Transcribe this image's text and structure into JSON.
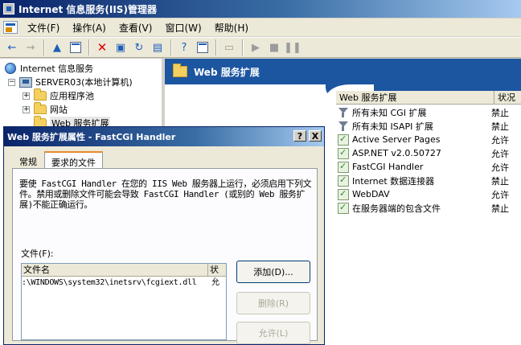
{
  "window": {
    "title": "Internet 信息服务(IIS)管理器"
  },
  "menu": [
    "文件(F)",
    "操作(A)",
    "查看(V)",
    "窗口(W)",
    "帮助(H)"
  ],
  "tree": {
    "root": "Internet 信息服务",
    "server": "SERVER03(本地计算机)",
    "children": [
      "应用程序池",
      "网站",
      "Web 服务扩展"
    ]
  },
  "pane": {
    "title": "Web 服务扩展",
    "columns": [
      "Web 服务扩展",
      "状况"
    ],
    "rows": [
      {
        "name": "所有未知 CGI 扩展",
        "status": "禁止",
        "icon": "filter-icon"
      },
      {
        "name": "所有未知 ISAPI 扩展",
        "status": "禁止",
        "icon": "filter-icon"
      },
      {
        "name": "Active Server Pages",
        "status": "允许",
        "icon": "allowed-icon"
      },
      {
        "name": "ASP.NET v2.0.50727",
        "status": "允许",
        "icon": "allowed-icon"
      },
      {
        "name": "FastCGI Handler",
        "status": "允许",
        "icon": "allowed-icon"
      },
      {
        "name": "Internet 数据连接器",
        "status": "禁止",
        "icon": "allowed-icon"
      },
      {
        "name": "WebDAV",
        "status": "允许",
        "icon": "allowed-icon"
      },
      {
        "name": "在服务器端的包含文件",
        "status": "禁止",
        "icon": "allowed-icon"
      }
    ]
  },
  "dialog": {
    "title": "Web 服务扩展属性 - FastCGI Handler",
    "help_btn": "?",
    "close_btn": "X",
    "tabs": [
      "常规",
      "要求的文件"
    ],
    "description": "要使 FastCGI Handler 在您的 IIS Web 服务器上运行，必须启用下列文件。禁用或删除文件可能会导致 FastCGI Handler (或别的 Web 服务扩展)不能正确运行。",
    "files_label": "文件(F):",
    "file_columns": [
      "文件名",
      "状"
    ],
    "files": [
      {
        "path": ":\\WINDOWS\\system32\\inetsrv\\fcgiext.dll",
        "status": "允"
      }
    ],
    "buttons": {
      "add": "添加(D)...",
      "remove": "删除(R)",
      "allow": "允许(L)"
    }
  }
}
